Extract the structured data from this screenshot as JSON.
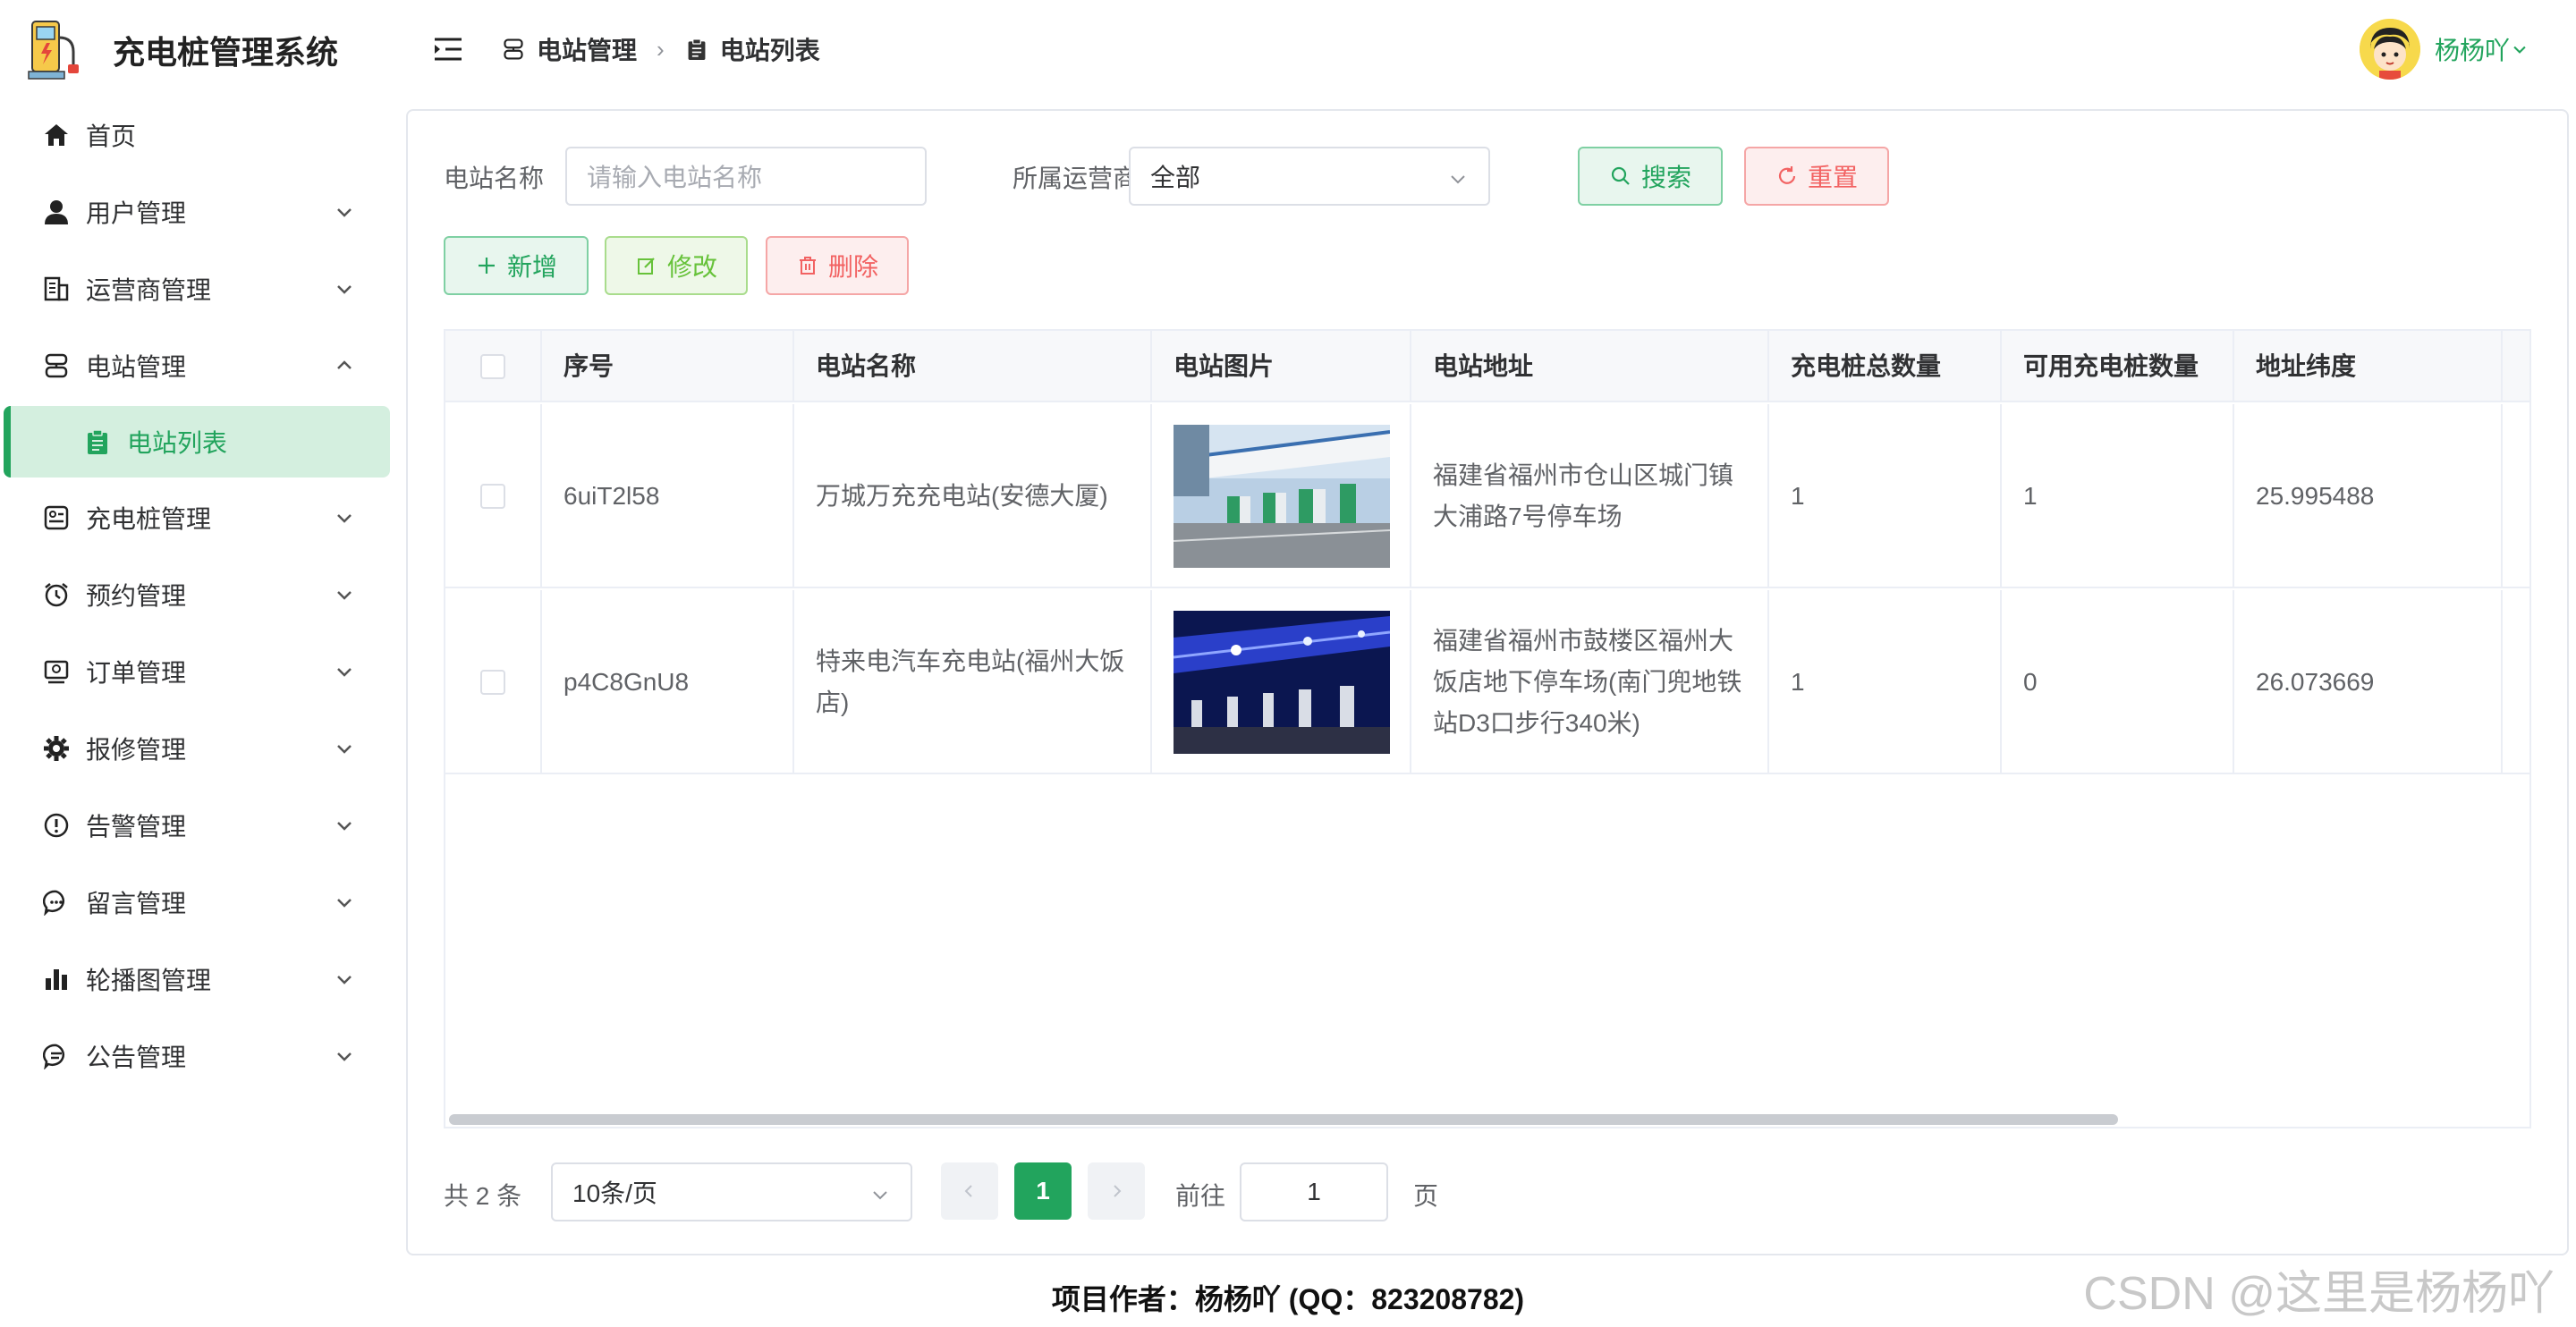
{
  "app": {
    "title": "充电桩管理系统"
  },
  "colors": {
    "primary": "#22a45d",
    "danger": "#f26262",
    "active_bg": "#d4efdf"
  },
  "sidebar": {
    "items": [
      {
        "label": "首页",
        "icon": "home-icon"
      },
      {
        "label": "用户管理",
        "icon": "user-icon"
      },
      {
        "label": "运营商管理",
        "icon": "building-icon"
      },
      {
        "label": "电站管理",
        "icon": "station-icon",
        "expanded": true
      },
      {
        "label": "电站列表",
        "icon": "clipboard-icon",
        "active": true
      },
      {
        "label": "充电桩管理",
        "icon": "charger-icon"
      },
      {
        "label": "预约管理",
        "icon": "alarm-clock-icon"
      },
      {
        "label": "订单管理",
        "icon": "order-icon"
      },
      {
        "label": "报修管理",
        "icon": "gear-icon"
      },
      {
        "label": "告警管理",
        "icon": "warning-icon"
      },
      {
        "label": "留言管理",
        "icon": "chat-icon"
      },
      {
        "label": "轮播图管理",
        "icon": "bar-chart-icon"
      },
      {
        "label": "公告管理",
        "icon": "notice-icon"
      }
    ]
  },
  "header": {
    "breadcrumb": [
      "电站管理",
      "电站列表"
    ],
    "user": "杨杨吖"
  },
  "search": {
    "name_label": "电站名称",
    "name_placeholder": "请输入电站名称",
    "operator_label": "所属运营商",
    "operator_value": "全部",
    "search_button": "搜索",
    "reset_button": "重置"
  },
  "actions": {
    "add": "新增",
    "edit": "修改",
    "delete": "删除"
  },
  "table": {
    "columns": [
      "序号",
      "电站名称",
      "电站图片",
      "电站地址",
      "充电桩总数量",
      "可用充电桩数量",
      "地址纬度"
    ],
    "rows": [
      {
        "id": "6uiT2l58",
        "name": "万城万充充电站(安德大厦)",
        "address": "福建省福州市仓山区城门镇大浦路7号停车场",
        "total": "1",
        "available": "1",
        "latitude": "25.995488"
      },
      {
        "id": "p4C8GnU8",
        "name": "特来电汽车充电站(福州大饭店)",
        "address": "福建省福州市鼓楼区福州大饭店地下停车场(南门兜地铁站D3口步行340米)",
        "total": "1",
        "available": "0",
        "latitude": "26.073669"
      }
    ]
  },
  "pagination": {
    "total_text": "共 2 条",
    "page_size": "10条/页",
    "current_page": "1",
    "goto_label": "前往",
    "goto_value": "1",
    "page_suffix": "页"
  },
  "footer": {
    "text": "项目作者：杨杨吖 (QQ：823208782)"
  },
  "watermark": "CSDN @这里是杨杨吖"
}
